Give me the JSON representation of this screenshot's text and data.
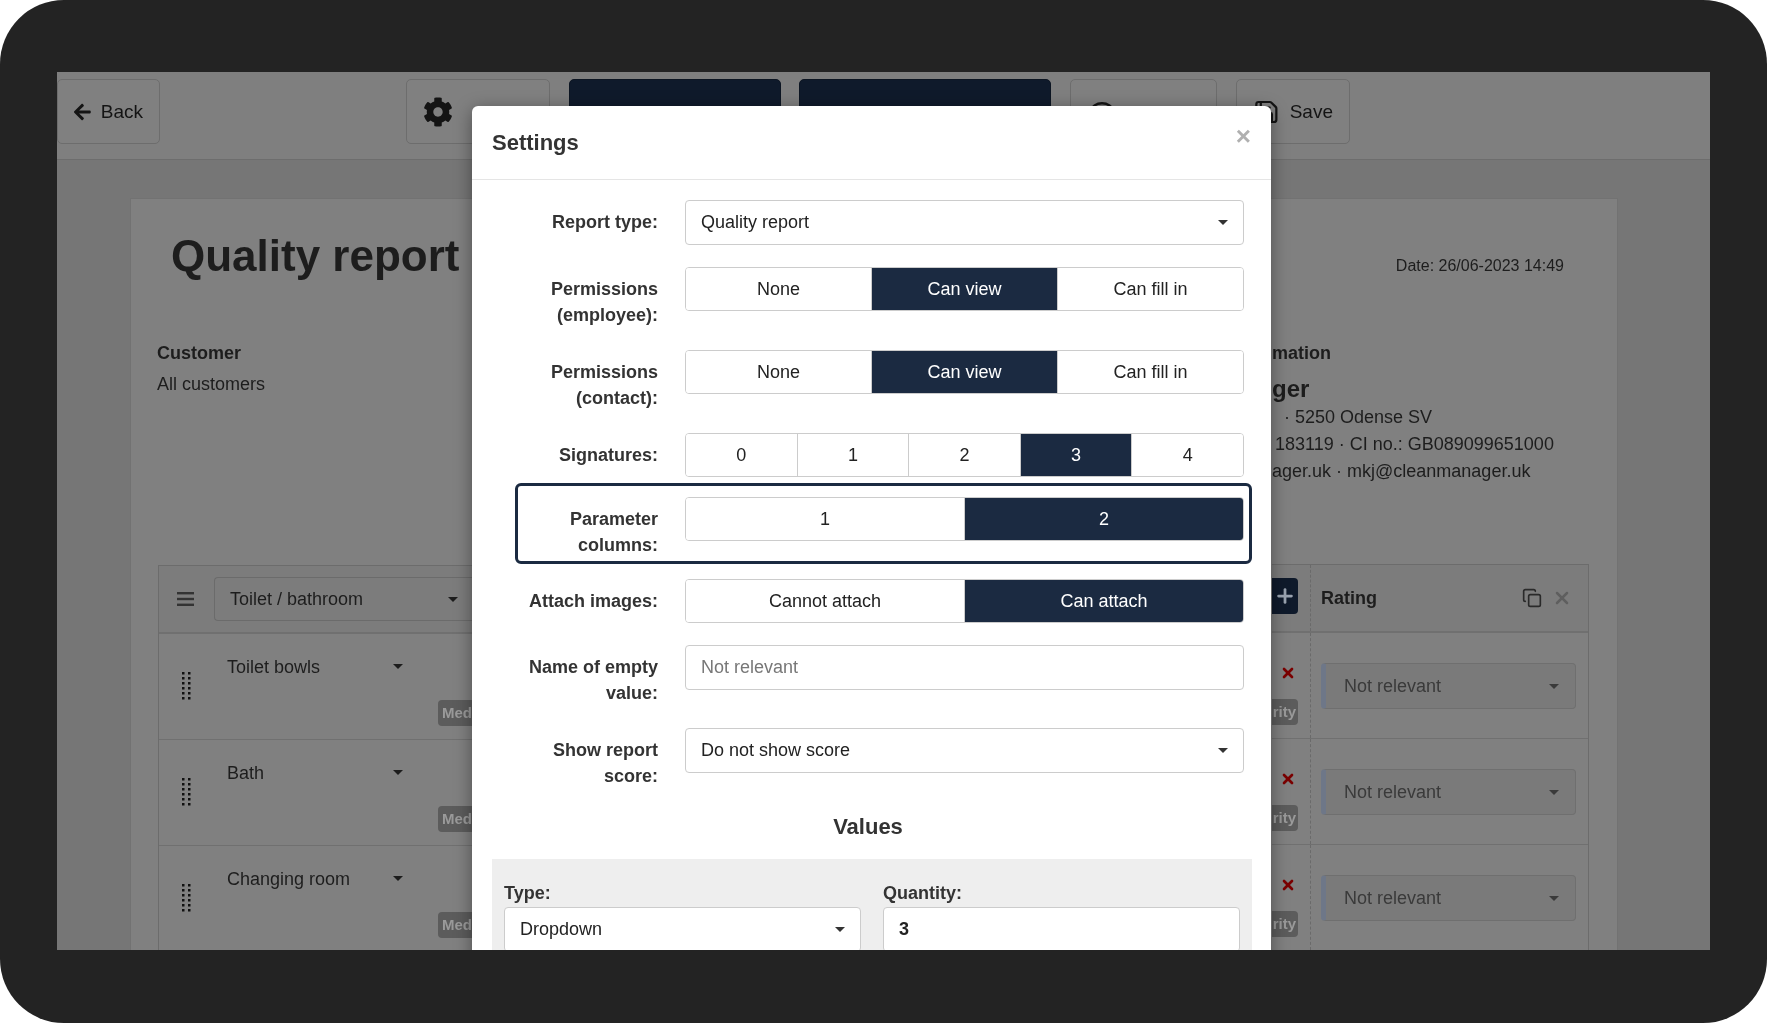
{
  "toolbar": {
    "buttons": [
      {
        "kind": "back",
        "label": "Back"
      },
      {
        "kind": "settings"
      },
      {
        "kind": "primary"
      },
      {
        "kind": "primary"
      },
      {
        "kind": "preview"
      },
      {
        "kind": "save",
        "label": "Save"
      }
    ]
  },
  "report": {
    "title": "Quality report",
    "date": "Date: 26/06-2023 14:49",
    "customer_label": "Customer",
    "customer_value": "All customers",
    "company": {
      "heading": "mation",
      "name": "ger",
      "lines": [
        "· 5250 Odense SV",
        "183119 · CI no.: GB089099651000",
        "ager.uk · mkj@cleanmanager.uk"
      ]
    }
  },
  "table": {
    "group": "Toilet / bathroom",
    "rating_header": "Rating",
    "rows": [
      {
        "name": "Toilet bowls",
        "badge_left": "Med",
        "badge_right": "rity",
        "rating": "Not relevant"
      },
      {
        "name": "Bath",
        "badge_left": "Med",
        "badge_right": "rity",
        "rating": "Not relevant"
      },
      {
        "name": "Changing room",
        "badge_left": "Med",
        "badge_right": "rity",
        "rating": "Not relevant"
      }
    ]
  },
  "modal": {
    "title": "Settings",
    "close": "×",
    "fields": [
      {
        "kind": "select",
        "label": "Report type:",
        "value": "Quality report"
      },
      {
        "kind": "segmented",
        "label": "Permissions (employee):",
        "options": [
          {
            "label": "None",
            "selected": false
          },
          {
            "label": "Can view",
            "selected": true
          },
          {
            "label": "Can fill in",
            "selected": false
          }
        ]
      },
      {
        "kind": "segmented",
        "label": "Permissions (contact):",
        "options": [
          {
            "label": "None",
            "selected": false
          },
          {
            "label": "Can view",
            "selected": true
          },
          {
            "label": "Can fill in",
            "selected": false
          }
        ]
      },
      {
        "kind": "segmented",
        "label": "Signatures:",
        "options": [
          {
            "label": "0",
            "selected": false
          },
          {
            "label": "1",
            "selected": false
          },
          {
            "label": "2",
            "selected": false
          },
          {
            "label": "3",
            "selected": true
          },
          {
            "label": "4",
            "selected": false
          }
        ]
      },
      {
        "kind": "segmented",
        "label": "Parameter columns:",
        "highlighted": true,
        "options": [
          {
            "label": "1",
            "selected": false
          },
          {
            "label": "2",
            "selected": true
          }
        ]
      },
      {
        "kind": "segmented",
        "label": "Attach images:",
        "options": [
          {
            "label": "Cannot attach",
            "selected": false
          },
          {
            "label": "Can attach",
            "selected": true
          }
        ]
      },
      {
        "kind": "text",
        "label": "Name of empty value:",
        "placeholder": "Not relevant"
      },
      {
        "kind": "select",
        "label": "Show report score:",
        "value": "Do not show score"
      }
    ],
    "values": {
      "title": "Values",
      "type_label": "Type:",
      "type_value": "Dropdown",
      "quantity_label": "Quantity:",
      "quantity_value": "3"
    }
  }
}
